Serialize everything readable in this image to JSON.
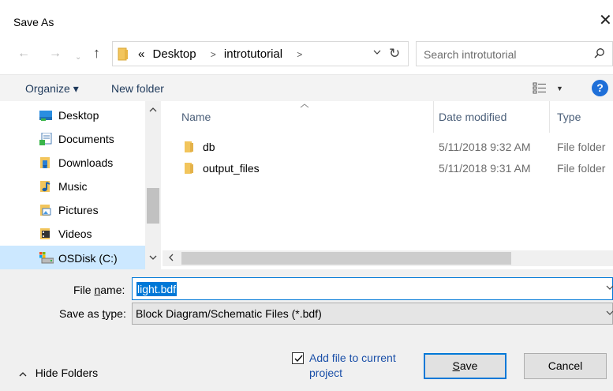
{
  "window": {
    "title": "Save As",
    "close_glyph": "✕"
  },
  "nav": {
    "back_glyph": "←",
    "forward_glyph": "→",
    "recent_glyph": "⌄",
    "up_glyph": "↑",
    "breadcrumb_overflow": "«",
    "breadcrumbs": [
      "Desktop",
      "introtutorial"
    ],
    "crumb_sep": ">",
    "refresh_glyph": "↻",
    "search_placeholder": "Search introtutorial"
  },
  "toolbar": {
    "organize_label": "Organize ▾",
    "new_folder_label": "New folder",
    "views_dd_glyph": "▼",
    "help_glyph": "?"
  },
  "sidebar": {
    "items": [
      {
        "label": "Desktop",
        "icon": "desktop-icon"
      },
      {
        "label": "Documents",
        "icon": "documents-icon"
      },
      {
        "label": "Downloads",
        "icon": "downloads-icon"
      },
      {
        "label": "Music",
        "icon": "music-icon"
      },
      {
        "label": "Pictures",
        "icon": "pictures-icon"
      },
      {
        "label": "Videos",
        "icon": "videos-icon"
      },
      {
        "label": "OSDisk (C:)",
        "icon": "drive-icon",
        "selected": true
      }
    ]
  },
  "files": {
    "columns": {
      "name": "Name",
      "date": "Date modified",
      "type": "Type"
    },
    "rows": [
      {
        "name": "db",
        "date": "5/11/2018 9:32 AM",
        "type": "File folder"
      },
      {
        "name": "output_files",
        "date": "5/11/2018 9:31 AM",
        "type": "File folder"
      }
    ]
  },
  "form": {
    "file_name_prefix": "File ",
    "file_name_underline": "n",
    "file_name_suffix": "ame:",
    "file_name_value": "light.bdf",
    "save_type_prefix": "Save as ",
    "save_type_underline": "t",
    "save_type_suffix": "ype:",
    "save_type_value": "Block Diagram/Schematic Files (*.bdf)",
    "add_to_project_label": "Add file to current project",
    "add_to_project_checked": true
  },
  "buttons": {
    "save_underline": "S",
    "save_rest": "ave",
    "cancel": "Cancel",
    "hide_folders": "Hide Folders"
  },
  "colors": {
    "accent": "#0078d7",
    "link": "#1a4fa8",
    "folder": "#f2c55c",
    "selected_bg": "#cce8ff"
  }
}
